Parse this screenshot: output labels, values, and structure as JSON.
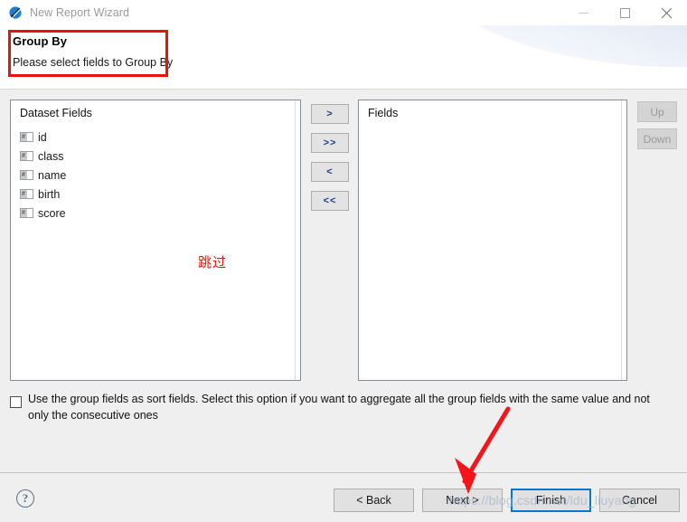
{
  "window": {
    "title": "New Report Wizard",
    "icon": "birt-report-icon",
    "controls": {
      "minimize": "minimize-icon",
      "maximize": "maximize-icon",
      "close": "close-icon"
    }
  },
  "header": {
    "title": "Group By",
    "subtitle": "Please select fields to Group By"
  },
  "dataset_panel": {
    "header": "Dataset Fields",
    "fields": [
      {
        "label": "id",
        "icon": "column-field-icon",
        "icon_glyph": "#"
      },
      {
        "label": "class",
        "icon": "column-field-icon",
        "icon_glyph": "#"
      },
      {
        "label": "name",
        "icon": "column-field-icon",
        "icon_glyph": "#"
      },
      {
        "label": "birth",
        "icon": "column-field-icon",
        "icon_glyph": "#"
      },
      {
        "label": "score",
        "icon": "column-field-icon",
        "icon_glyph": "#"
      }
    ]
  },
  "transfer_buttons": [
    {
      "label": ">",
      "name": "add-selected-button"
    },
    {
      "label": ">>",
      "name": "add-all-button"
    },
    {
      "label": "<",
      "name": "remove-selected-button"
    },
    {
      "label": "<<",
      "name": "remove-all-button"
    }
  ],
  "fields_panel": {
    "header": "Fields",
    "items": []
  },
  "order_buttons": [
    {
      "label": "Up",
      "name": "move-up-button",
      "enabled": false
    },
    {
      "label": "Down",
      "name": "move-down-button",
      "enabled": false
    }
  ],
  "sort_option": {
    "checked": false,
    "label": "Use the group fields as sort fields. Select this option if you want to aggregate all the group fields with the same value and not only the consecutive ones"
  },
  "footer": {
    "help_icon": "?",
    "buttons": [
      {
        "label": "< Back",
        "name": "back-button",
        "default": false
      },
      {
        "label": "Next >",
        "name": "next-button",
        "default": false
      },
      {
        "label": "Finish",
        "name": "finish-button",
        "default": true
      },
      {
        "label": "Cancel",
        "name": "cancel-button",
        "default": false
      }
    ]
  },
  "annotations": {
    "skip_text": "跳过",
    "arrow": "red-arrow-pointing-to-next-button",
    "box": "red-highlight-box-on-header"
  },
  "watermark": {
    "text": "https://blog.csdn.net/ldu_liuyang"
  },
  "colors": {
    "accent": "#0078d7",
    "annotation_red": "#e8140c",
    "dialog_bg": "#efefef",
    "button_bg": "#e1e1e1",
    "list_bg": "#ffffff"
  }
}
